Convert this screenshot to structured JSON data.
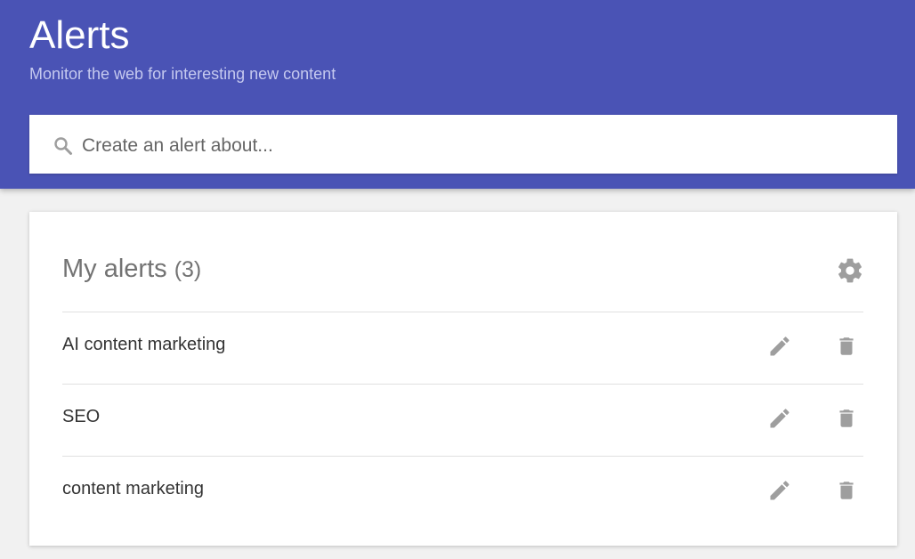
{
  "header": {
    "title": "Alerts",
    "subtitle": "Monitor the web for interesting new content",
    "background_color": "#4a53b5"
  },
  "search": {
    "placeholder": "Create an alert about...",
    "value": "",
    "icon": "search-icon"
  },
  "alerts_card": {
    "title": "My alerts",
    "count": "(3)",
    "settings_icon": "gear-icon",
    "items": [
      {
        "label": "AI content marketing",
        "edit_icon": "pencil-icon",
        "delete_icon": "trash-icon"
      },
      {
        "label": "SEO",
        "edit_icon": "pencil-icon",
        "delete_icon": "trash-icon"
      },
      {
        "label": "content marketing",
        "edit_icon": "pencil-icon",
        "delete_icon": "trash-icon"
      }
    ]
  }
}
